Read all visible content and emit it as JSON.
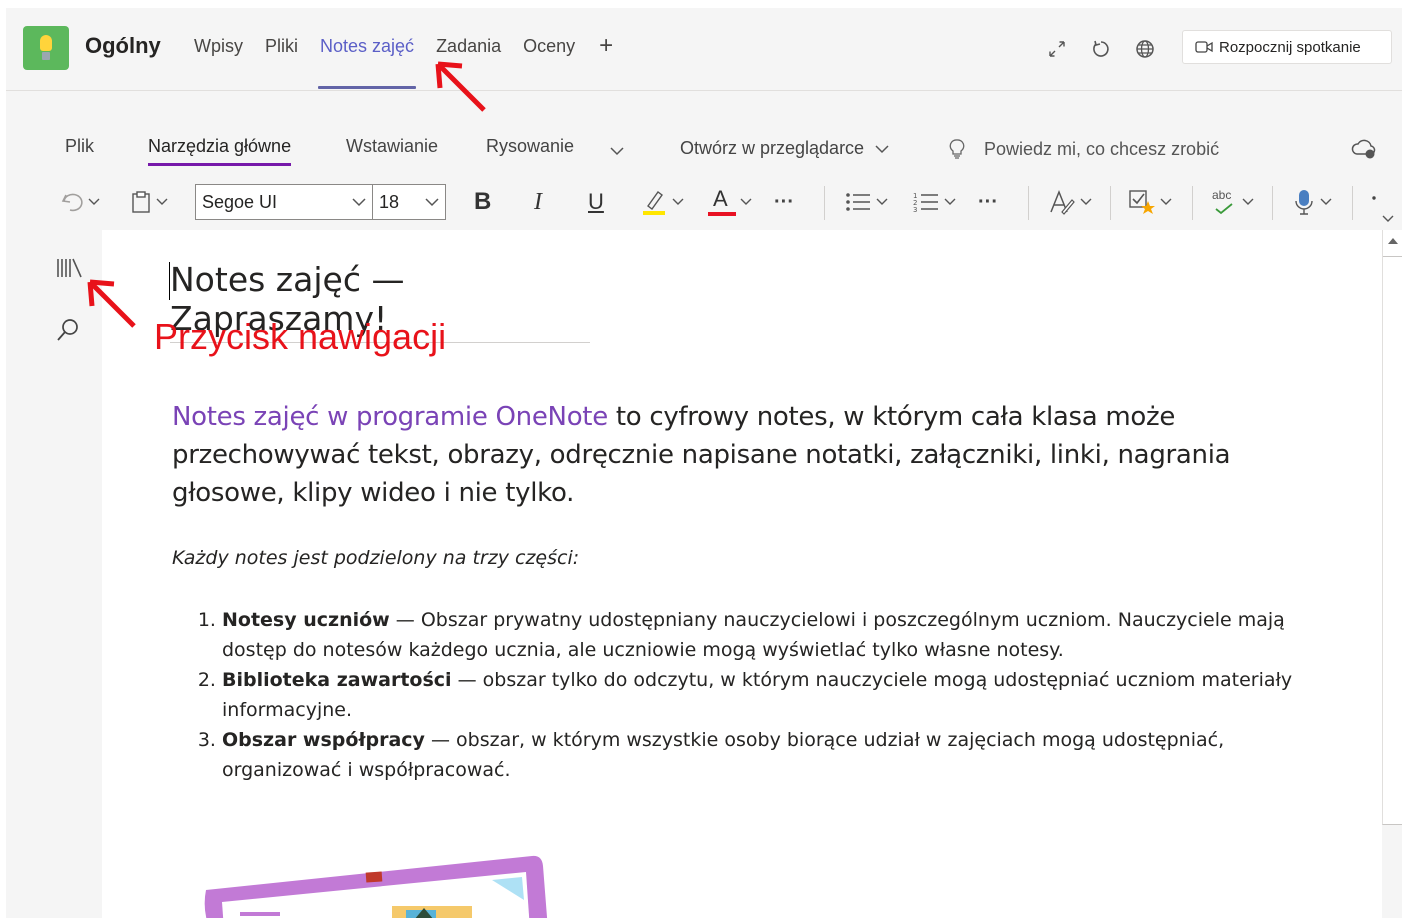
{
  "team": {
    "name": "Ogólny"
  },
  "tabs": [
    {
      "label": "Wpisy",
      "active": false
    },
    {
      "label": "Pliki",
      "active": false
    },
    {
      "label": "Notes zajęć",
      "active": true
    },
    {
      "label": "Zadania",
      "active": false
    },
    {
      "label": "Oceny",
      "active": false
    }
  ],
  "header": {
    "add_tab_glyph": "+",
    "meet_button": "Rozpocznij spotkanie",
    "icons": [
      "expand-icon",
      "refresh-icon",
      "globe-icon"
    ]
  },
  "ribbon": {
    "tabs": [
      {
        "label": "Plik",
        "active": false
      },
      {
        "label": "Narzędzia główne",
        "active": true
      },
      {
        "label": "Wstawianie",
        "active": false
      },
      {
        "label": "Rysowanie",
        "active": false
      }
    ],
    "open_in_browser": "Otwórz w przeglądarce",
    "tell_me": "Powiedz mi, co chcesz zrobić",
    "font_family": "Segoe UI",
    "font_size": "18",
    "bold": "B",
    "italic": "I",
    "underline": "U",
    "font_color_glyph": "A",
    "more_glyph": "···",
    "spelling_glyph": "abc",
    "accent_color": "#7719aa",
    "font_color": "#e81123",
    "highlight_color": "#ffe600"
  },
  "page": {
    "title": "Notes zajęć — Zapraszamy!",
    "intro_link": "Notes zajęć w programie OneNote",
    "intro_rest": " to cyfrowy notes, w którym cała klasa może przechowywać tekst, obrazy, odręcznie napisane notatki, załączniki, linki, nagrania głosowe, klipy wideo i nie tylko.",
    "parts_heading": "Każdy notes jest podzielony na trzy części:",
    "parts": [
      {
        "term": "Notesy uczniów",
        "desc": " — Obszar prywatny udostępniany nauczycielowi i poszczególnym uczniom. Nauczyciele mają dostęp do notesów każdego ucznia, ale uczniowie mogą wyświetlać tylko własne notesy."
      },
      {
        "term": "Biblioteka zawartości",
        "desc": " — obszar tylko do odczytu, w którym nauczyciele mogą udostępniać uczniom materiały informacyjne."
      },
      {
        "term": "Obszar współpracy",
        "desc": " — obszar, w którym wszystkie osoby biorące udział w zajęciach mogą udostępniać, organizować i współpracować."
      }
    ]
  },
  "annotation": {
    "label": "Przycisk nawigacji",
    "color": "#e8121a"
  }
}
